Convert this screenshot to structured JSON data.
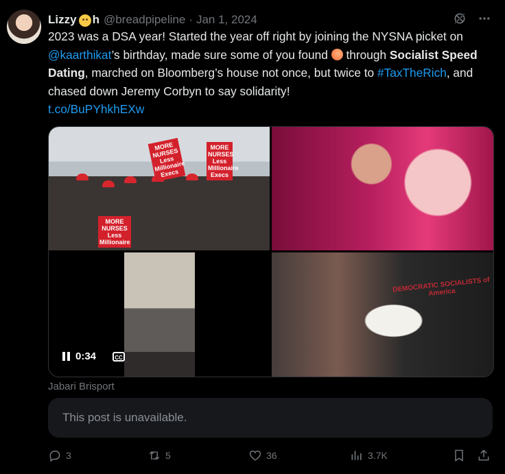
{
  "author": {
    "name": "Lizzy",
    "name_suffix": "h",
    "handle": "@breadpipeline",
    "separator": "·",
    "date": "Jan 1, 2024",
    "avatar_icon": "profile-photo",
    "emoji_icon": "smiley-emoji"
  },
  "post": {
    "t1": "2023 was a DSA year! Started the year off right by joining the NYSNA picket on ",
    "mention": "@kaarthikat",
    "t2": "’s birthday, made sure some of you found ",
    "peach_icon": "peach-emoji",
    "t3": " through ",
    "bold": "Socialist Speed Dating",
    "t4": ", marched on Bloomberg’s house not once, but twice to ",
    "hashtag": "#TaxTheRich",
    "t5": ", and chased down Jeremy Corbyn to say solidarity!",
    "link": "t.co/BuPYhkhEXw"
  },
  "media": {
    "sign_1": "MORE NURSES Less Millionaire Execs",
    "sign_2": "MORE NURSES Less Millionaire Execs",
    "sign_3": "MORE NURSES Less Millionaire",
    "video_time": "0:34",
    "cc_label": "CC",
    "shirt_text": "DEMOCRATIC SOCIALISTS of America"
  },
  "attribution": "Jabari Brisport",
  "quoted": {
    "text": "This post is unavailable."
  },
  "actions": {
    "replies": "3",
    "reposts": "5",
    "likes": "36",
    "views": "3.7K"
  },
  "colors": {
    "background": "#000000",
    "text": "#e7e9ea",
    "muted": "#71767b",
    "link": "#1d9bf0",
    "card": "#16181c"
  }
}
